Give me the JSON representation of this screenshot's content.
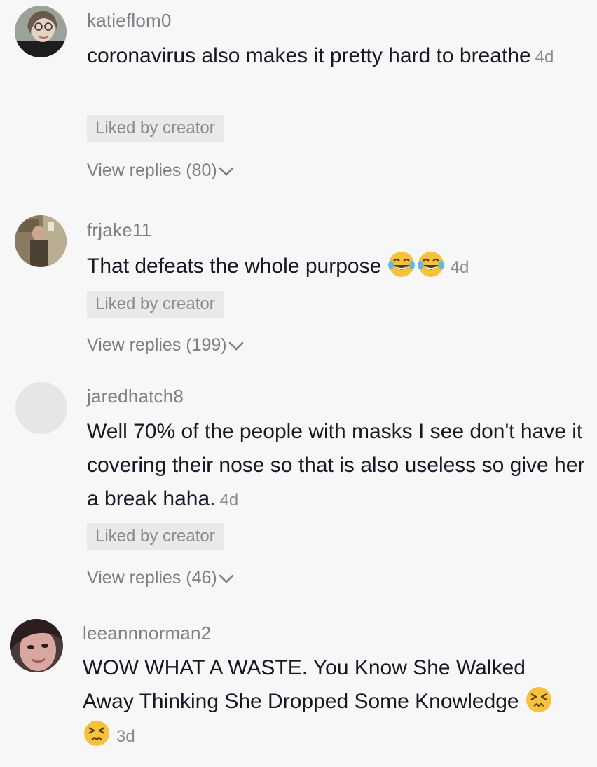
{
  "comments": [
    {
      "username": "katieflom0",
      "text": "coronavirus also makes it pretty hard to breathe",
      "time": "4d",
      "liked": "Liked by creator",
      "replies": "View replies (80)"
    },
    {
      "username": "frjake11",
      "text": "That defeats the whole purpose",
      "emojis": [
        "tears-of-joy-emoji",
        "tears-of-joy-emoji"
      ],
      "time": "4d",
      "liked": "Liked by creator",
      "replies": "View replies (199)"
    },
    {
      "username": "jaredhatch8",
      "text": "Well 70% of the people with masks I see don't have it covering their nose so that is also useless so give her a break haha.",
      "time": "4d",
      "liked": "Liked by creator",
      "replies": "View replies (46)"
    },
    {
      "username": "leeannnorman2",
      "text": "WOW WHAT A WASTE. You Know She Walked Away Thinking She Dropped Some Knowledge",
      "emojis": [
        "persevering-face-emoji",
        "persevering-face-emoji"
      ],
      "time": "3d"
    }
  ],
  "colors": {
    "background": "#f7f7f7",
    "text": "#161823",
    "secondary": "#7e7e84",
    "badge_bg": "#e9e9ea"
  }
}
